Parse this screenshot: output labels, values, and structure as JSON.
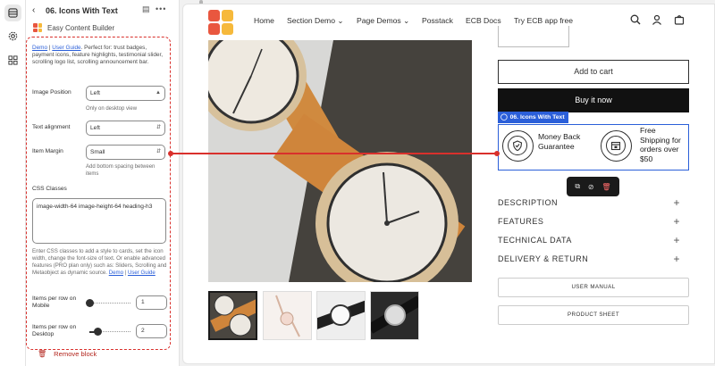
{
  "sidebar_header": {
    "back_icon": "chevron-left-icon",
    "title": "06. Icons With Text",
    "app_name": "Easy Content Builder"
  },
  "intro": {
    "demo_link": "Demo",
    "separator": " | ",
    "guide_link": "User Guide",
    "text": ". Perfect for: trust badges, payment icons, feature highlights, testimonial slider, scrolling logo list, scrolling announcement bar."
  },
  "fields": {
    "image_position": {
      "label": "Image Position",
      "value": "Left",
      "hint": "Only on desktop view"
    },
    "text_alignment": {
      "label": "Text alignment",
      "value": "Left"
    },
    "item_margin": {
      "label": "Item Margin",
      "value": "Small",
      "hint": "Add bottom spacing between items"
    },
    "css_classes": {
      "label": "CSS Classes",
      "value": "image-width-64 image-height-64 heading-h3",
      "note": "Enter CSS classes to add a style to cards, set the icon width, change the font-size of text. Or enable advanced features (PRO plan only) such as: Sliders, Scrolling and Metaobject as dynamic source. ",
      "note_demo_link": "Demo",
      "note_separator": " | ",
      "note_guide_link": "User Guide"
    },
    "items_mobile": {
      "label": "Items per row on Mobile",
      "value": "1",
      "fraction": 0
    },
    "items_desktop": {
      "label": "Items per row on Desktop",
      "value": "2",
      "fraction": 0.2
    }
  },
  "remove_block": "Remove block",
  "site": {
    "nav": [
      "Home",
      "Section Demo",
      "Page Demos",
      "Posstack",
      "ECB Docs",
      "Try ECB app free"
    ],
    "nav_dropdown_flags": [
      false,
      true,
      true,
      false,
      false,
      false
    ],
    "logo_colors": [
      "#e9573f",
      "#f6b93b",
      "#e9573f",
      "#f6b93b"
    ],
    "header_icons": [
      "search-icon",
      "account-icon",
      "cart-icon"
    ]
  },
  "product": {
    "add_to_cart": "Add to cart",
    "buy_now": "Buy it now",
    "section_tag": "06. Icons With Text",
    "badges": [
      {
        "icon": "shield-check-icon",
        "text_lines": [
          "Money Back",
          "Guarantee"
        ]
      },
      {
        "icon": "package-icon",
        "text_lines": [
          "Free",
          "Shipping for",
          "orders over",
          "$50"
        ]
      }
    ],
    "toolbar_icons": [
      "duplicate-icon",
      "hide-icon",
      "delete-icon"
    ],
    "accordion": [
      "DESCRIPTION",
      "FEATURES",
      "TECHNICAL DATA",
      "DELIVERY & RETURN"
    ],
    "outline_buttons": [
      "USER MANUAL",
      "PRODUCT SHEET"
    ]
  },
  "colors": {
    "accent_blue": "#2b5fd9",
    "highlight_red": "#d9302c",
    "danger": "#b3261e"
  }
}
